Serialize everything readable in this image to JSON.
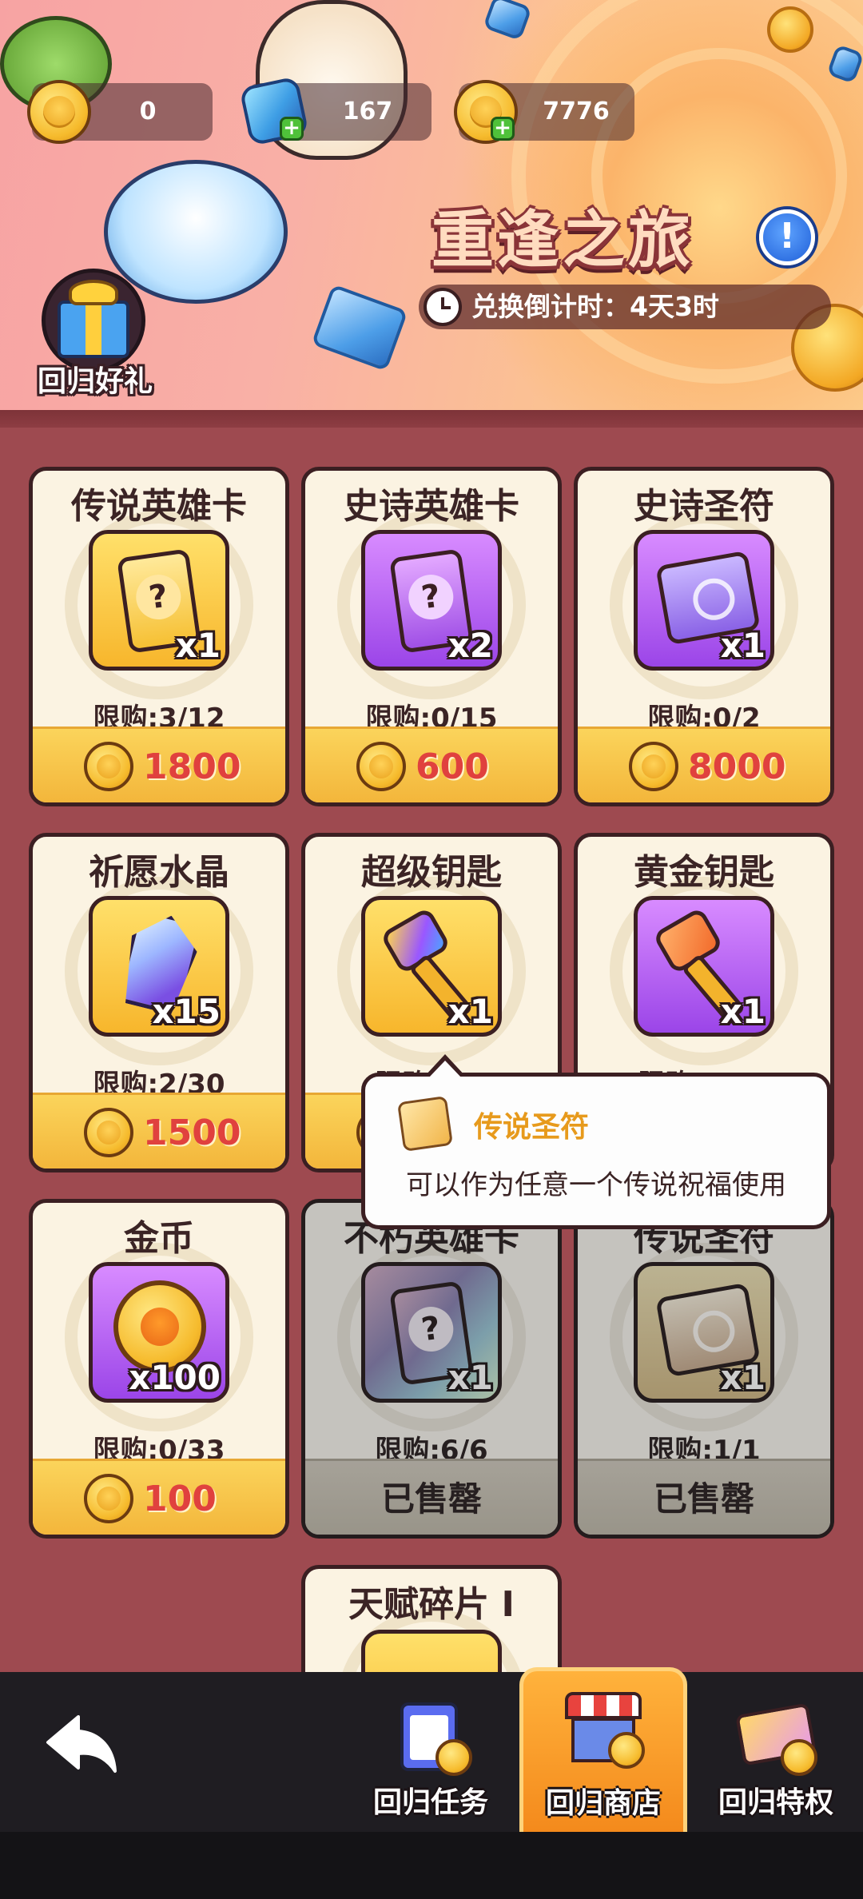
{
  "header": {
    "currencies": [
      {
        "name": "coin",
        "value": "0"
      },
      {
        "name": "gem",
        "value": "167"
      },
      {
        "name": "return-coin",
        "value": "7776"
      }
    ],
    "event_title": "重逢之旅",
    "info_icon": "!",
    "timer": "兑换倒计时：4天3时",
    "gift_label": "回归好礼"
  },
  "shop": {
    "items": [
      {
        "name": "传说英雄卡",
        "qty": "x1",
        "limit": "限购:3/12",
        "price": "1800",
        "icon": "gold-hero-card"
      },
      {
        "name": "史诗英雄卡",
        "qty": "x2",
        "limit": "限购:0/15",
        "price": "600",
        "icon": "purple-hero-card"
      },
      {
        "name": "史诗圣符",
        "qty": "x1",
        "limit": "限购:0/2",
        "price": "8000",
        "icon": "purple-rune-scroll"
      },
      {
        "name": "祈愿水晶",
        "qty": "x15",
        "limit": "限购:2/30",
        "price": "1500",
        "icon": "crystal"
      },
      {
        "name": "超级钥匙",
        "qty": "x1",
        "limit": "限购:0/5",
        "price": "",
        "icon": "super-key"
      },
      {
        "name": "黄金钥匙",
        "qty": "x1",
        "limit": "限购:0/10",
        "price": "",
        "icon": "gold-key"
      },
      {
        "name": "金币",
        "qty": "x100",
        "limit": "限购:0/33",
        "price": "100",
        "icon": "gold-coin"
      },
      {
        "name": "不朽英雄卡",
        "qty": "x1",
        "limit": "限购:6/6",
        "sold": "已售罄",
        "icon": "immortal-hero-card"
      },
      {
        "name": "传说圣符",
        "qty": "x1",
        "limit": "限购:1/1",
        "sold": "已售罄",
        "icon": "legend-rune-scroll"
      },
      {
        "name": "天赋碎片 I",
        "icon": "talent-shard"
      }
    ]
  },
  "tooltip": {
    "title": "传说圣符",
    "description": "可以作为任意一个传说祝福使用",
    "icon": "legend-rune-scroll"
  },
  "nav": {
    "back_icon": "back-arrow",
    "tabs": [
      {
        "label": "回归任务",
        "active": false
      },
      {
        "label": "回归商店",
        "active": true
      },
      {
        "label": "回归特权",
        "active": false
      }
    ]
  },
  "colors": {
    "background": "#9e4a50",
    "price_text": "#e0413e",
    "tooltip_title": "#e79a1c",
    "active_tab": "#f48a1c"
  }
}
